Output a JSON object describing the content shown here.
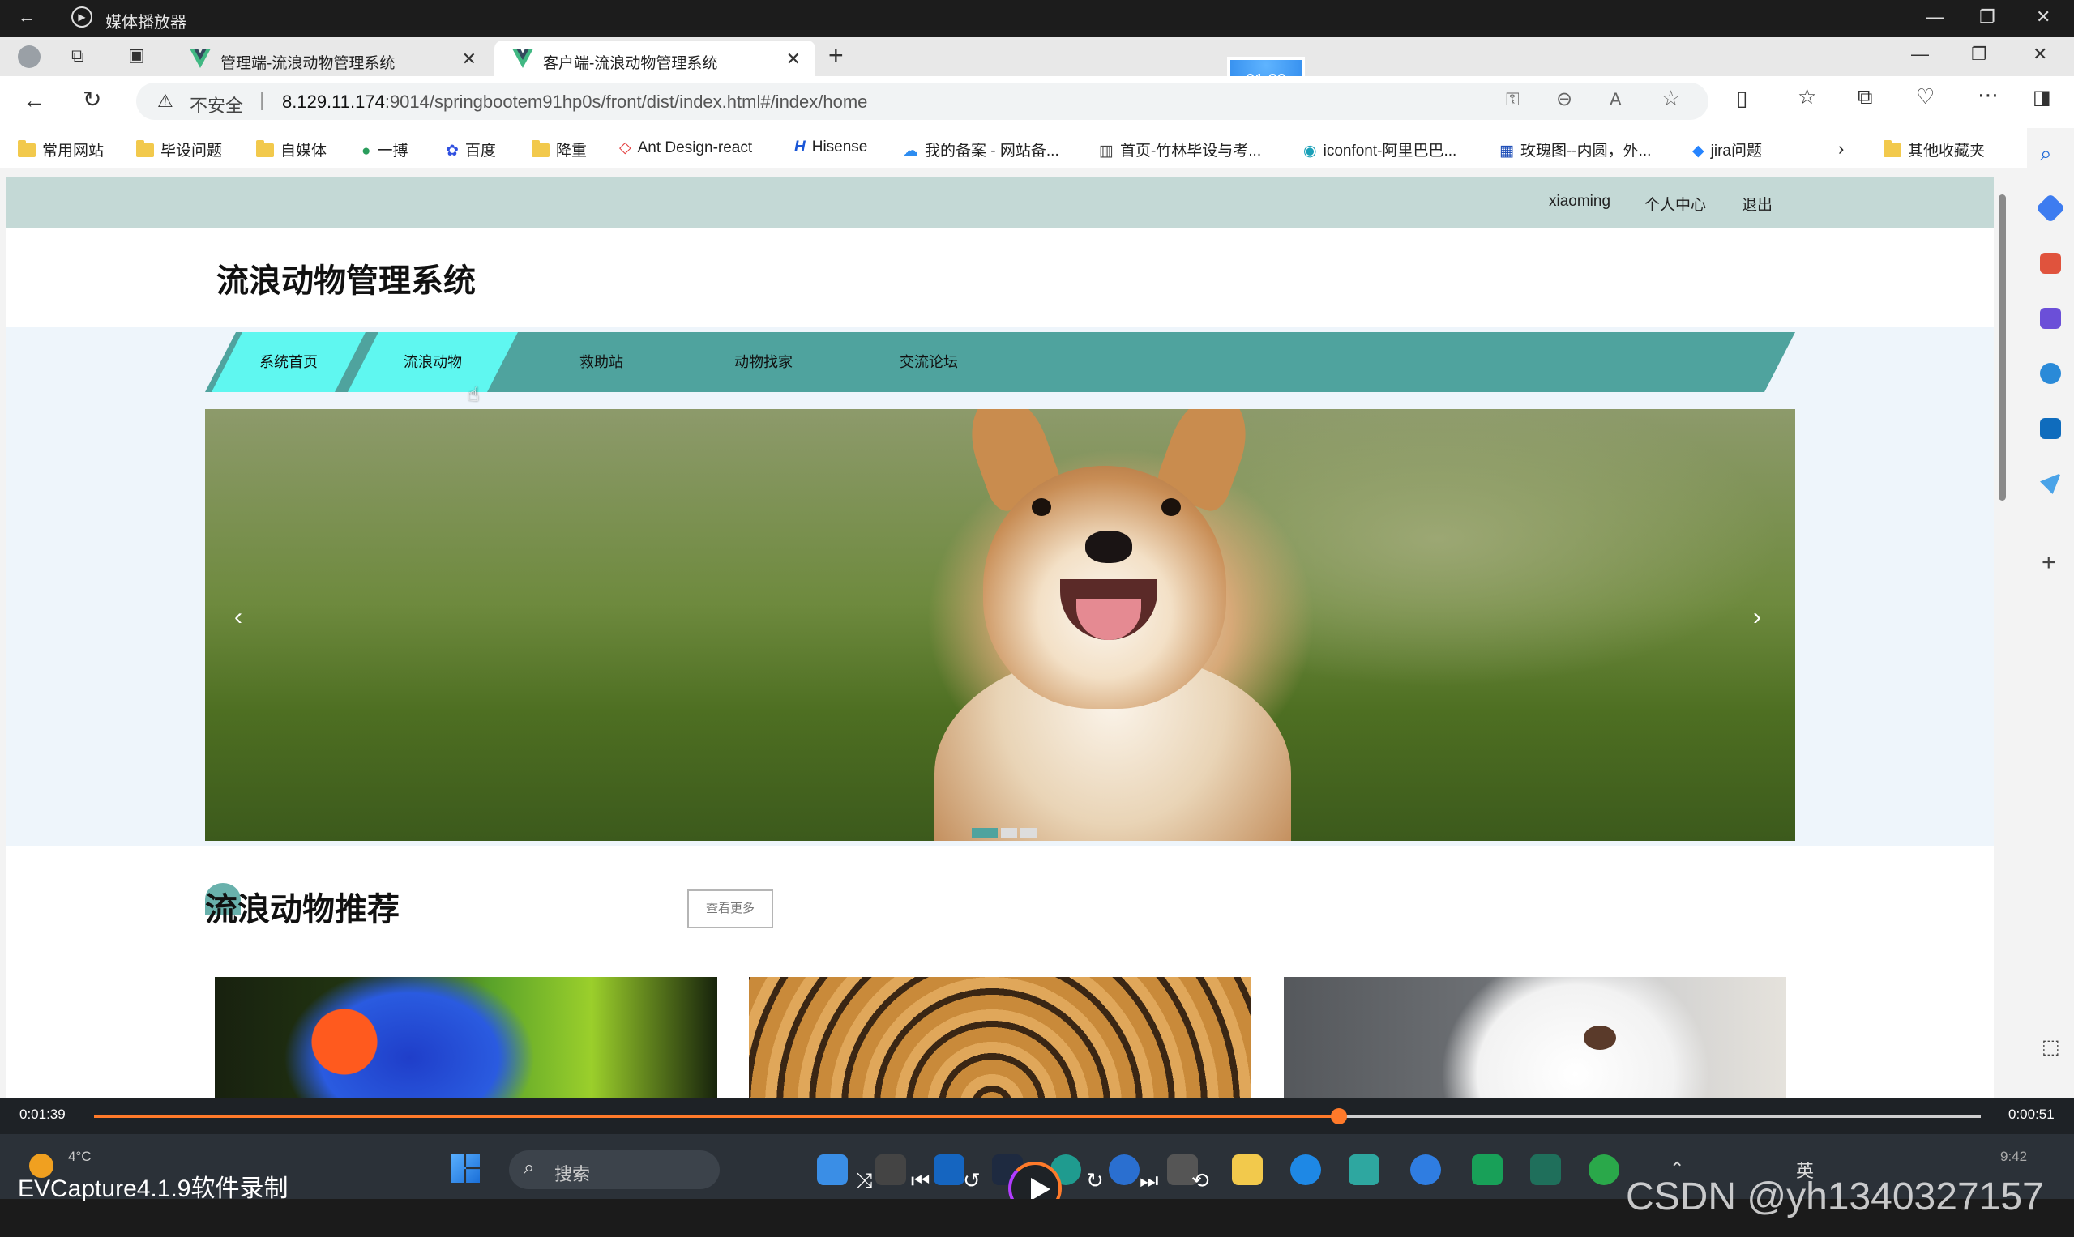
{
  "player": {
    "title": "媒体播放器",
    "time_elapsed": "0:01:39",
    "time_remaining": "0:00:51",
    "progress_fraction": 0.66,
    "badge_time": "01:39",
    "watermark": "EVCapture4.1.9软件录制",
    "csdn": "CSDN @yh1340327157"
  },
  "browser": {
    "tabs": [
      {
        "label": "管理端-流浪动物管理系统"
      },
      {
        "label": "客户端-流浪动物管理系统"
      }
    ],
    "address": {
      "unsafe_label": "不安全",
      "url_host": "8.129.11.174",
      "url_rest": ":9014/springbootem91hp0s/front/dist/index.html#/index/home"
    },
    "bookmarks": [
      {
        "label": "常用网站",
        "icon": "folder-icon"
      },
      {
        "label": "毕设问题",
        "icon": "folder-icon"
      },
      {
        "label": "自媒体",
        "icon": "folder-icon"
      },
      {
        "label": "一搏",
        "icon": "site-icon"
      },
      {
        "label": "百度",
        "icon": "baidu-icon"
      },
      {
        "label": "降重",
        "icon": "folder-icon"
      },
      {
        "label": "Ant Design-react",
        "icon": "antd-icon"
      },
      {
        "label": "Hisense",
        "icon": "hisense-icon"
      },
      {
        "label": "我的备案 - 网站备...",
        "icon": "cloud-icon"
      },
      {
        "label": "首页-竹林毕设与考...",
        "icon": "site-icon"
      },
      {
        "label": "iconfont-阿里巴巴...",
        "icon": "iconfont-icon"
      },
      {
        "label": "玫瑰图--内圆，外...",
        "icon": "chart-icon"
      },
      {
        "label": "jira问题",
        "icon": "jira-icon"
      },
      {
        "label": "其他收藏夹",
        "icon": "folder-icon"
      }
    ]
  },
  "site": {
    "top_links": {
      "user": "xiaoming",
      "profile": "个人中心",
      "logout": "退出"
    },
    "title": "流浪动物管理系统",
    "nav": [
      {
        "label": "系统首页"
      },
      {
        "label": "流浪动物"
      },
      {
        "label": "救助站"
      },
      {
        "label": "动物找家"
      },
      {
        "label": "交流论坛"
      }
    ],
    "carousel": {
      "prev": "‹",
      "next": "›"
    },
    "section_title": "流浪动物推荐",
    "more_button": "查看更多"
  },
  "taskbar": {
    "search_placeholder": "搜索",
    "weather": "4°C",
    "ime": "英",
    "clock": "9:42"
  }
}
